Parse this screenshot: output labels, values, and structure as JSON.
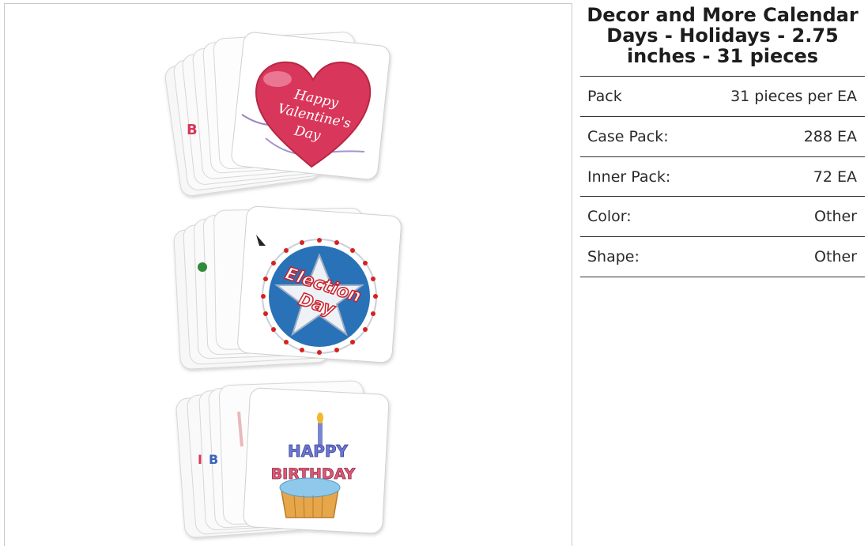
{
  "product": {
    "title": "Decor and More Calendar Days - Holidays - 2.75 inches - 31 pieces",
    "card_texts": {
      "valentine": [
        "Happy",
        "Valentine's",
        "Day"
      ],
      "election": [
        "Election",
        "Day"
      ],
      "birthday_top": "HAPPY",
      "birthday_bottom": "BIRTHDAY"
    },
    "colors": {
      "heart": "#d8365a",
      "election_blue": "#2a72b8",
      "birthday_cupcake": "#e6a64a"
    }
  },
  "specs": [
    {
      "label": "Pack",
      "value": "31 pieces per EA"
    },
    {
      "label": "Case Pack:",
      "value": "288 EA"
    },
    {
      "label": "Inner Pack:",
      "value": "72 EA"
    },
    {
      "label": "Color:",
      "value": "Other"
    },
    {
      "label": "Shape:",
      "value": "Other"
    }
  ]
}
